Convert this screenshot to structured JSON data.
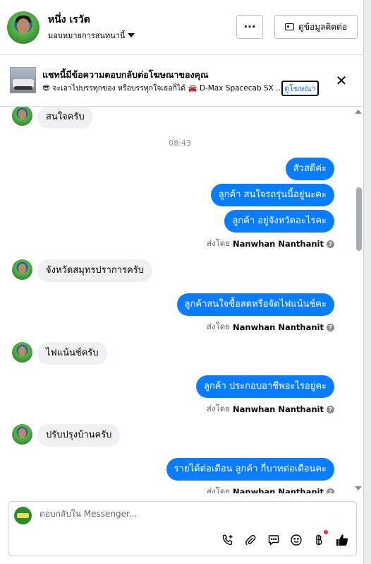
{
  "header": {
    "contact_name": "หนึ่ง เรวัต",
    "assign_label": "มอบหมายการสนทนานี้",
    "more_label": "···",
    "info_button_label": "ดูข้อมูลติดต่อ"
  },
  "ad_banner": {
    "title": "แชทนี้มีข้อความตอบกลับต่อโฆษณาของคุณ",
    "subtitle": "😎 จะเอาไปบรรทุกของ หรือบรรทุกใจเธอก็ได้ 🚘 D-Max Spacecab SX ...",
    "link_label": "ดูโฆษณา",
    "close_label": "✕"
  },
  "messages": {
    "m1": "สนใจครับ",
    "time": "08:43",
    "m2": "สัวสดีค่ะ",
    "m3": "ลูกค้า สนใจรถรุ่นนี้อยู่นะคะ",
    "m4": "ลูกค้า  อยู่จังหวัดอะไรคะ",
    "m5": "จังหวัดสมุทรปราการครับ",
    "m6": "ลูกค้าสนใจซื้อสดหรือจัดไฟแน้นช์คะ",
    "m7": "ไฟแน้นช์ครับ",
    "m8": "ลูกค้า ประกอบอาชีพอะไรอยู่คะ",
    "m9": "ปรับปรุงบ้านครับ",
    "m10": "รายได้ต่อเดือน ลูกค้า กี่บาทต่อเดือนคะ",
    "sent_by_prefix": "ส่งโดย",
    "sender_name": "Nanwhan Nanthanit",
    "info_glyph": "?"
  },
  "composer": {
    "placeholder": "ตอบกลับใน Messenger..."
  },
  "icons": {
    "call": "phone-plus-icon",
    "attach": "paperclip-icon",
    "saved_replies": "chat-bubble-icon",
    "emoji": "smiley-icon",
    "payment": "baht-icon",
    "like": "thumbs-up-icon"
  },
  "colors": {
    "outgoing_bubble": "#0a7cff",
    "incoming_bubble": "#eef0f2",
    "link": "#1b74e4",
    "like_button": "#050505"
  }
}
